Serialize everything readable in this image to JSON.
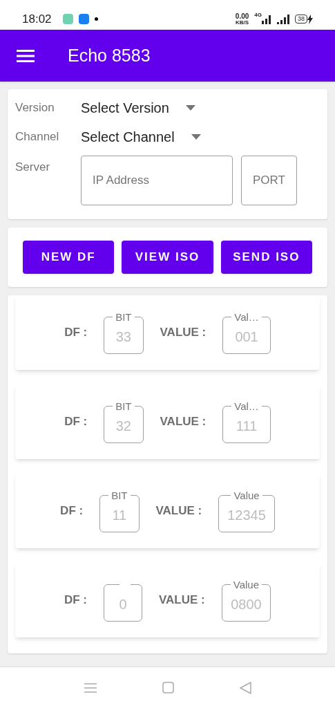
{
  "status_bar": {
    "time": "18:02",
    "net_speed": "0.00",
    "net_unit": "KB/S",
    "network": "4G",
    "battery": "38"
  },
  "app_bar": {
    "title": "Echo 8583"
  },
  "settings": [
    {
      "kind": "dropdown",
      "label": "Version",
      "value": "Select Version"
    },
    {
      "kind": "dropdown",
      "label": "Channel",
      "value": "Select Channel"
    },
    {
      "kind": "server",
      "label": "Server",
      "ip_placeholder": "IP Address",
      "port_placeholder": "PORT"
    }
  ],
  "buttons": [
    "NEW DF",
    "VIEW ISO",
    "SEND ISO"
  ],
  "rows": [
    {
      "df_label": "DF :",
      "bit": {
        "label": "BIT",
        "value": "33"
      },
      "value_label": "VALUE :",
      "value": {
        "label": "Val…",
        "value": "001"
      }
    },
    {
      "df_label": "DF :",
      "bit": {
        "label": "BIT",
        "value": "32"
      },
      "value_label": "VALUE :",
      "value": {
        "label": "Val…",
        "value": "111"
      }
    },
    {
      "df_label": "DF :",
      "bit": {
        "label": "BIT",
        "value": "11"
      },
      "value_label": "VALUE :",
      "value": {
        "label": "Value",
        "value": "12345"
      }
    },
    {
      "df_label": "DF :",
      "bit": {
        "value": "0"
      },
      "value_label": "VALUE :",
      "value": {
        "label": "Value",
        "value": "0800"
      }
    }
  ]
}
